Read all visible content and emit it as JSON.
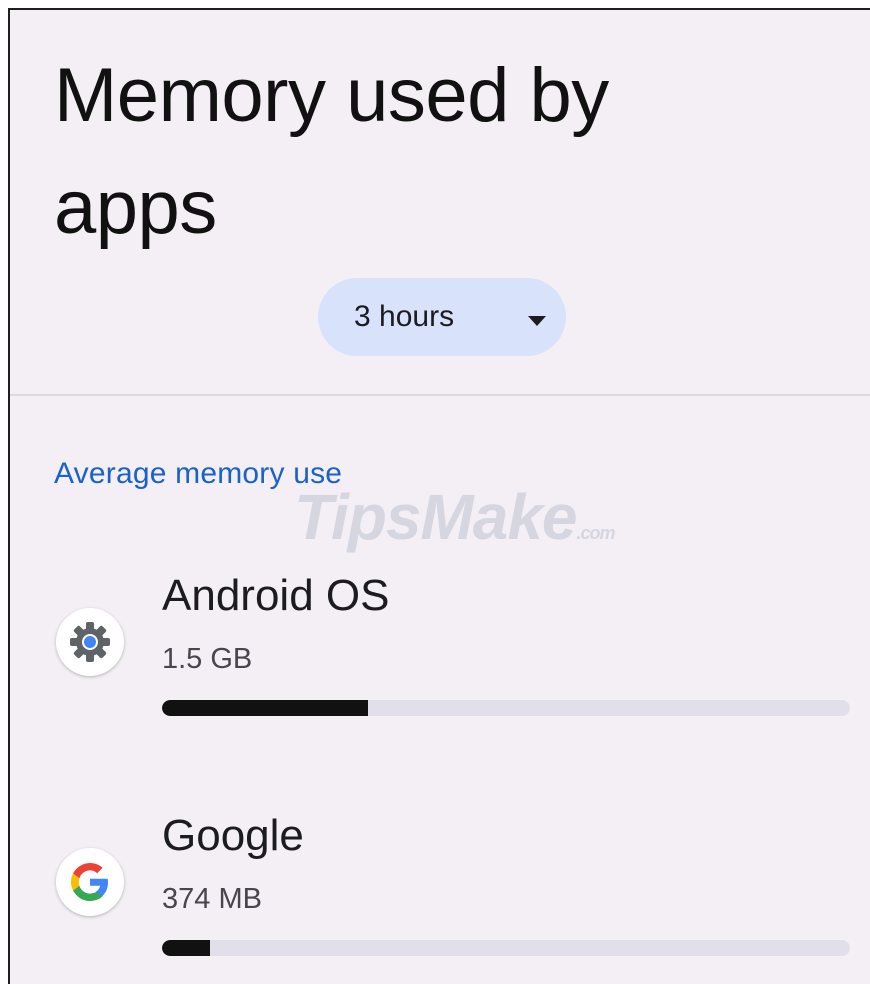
{
  "header": {
    "title": "Memory used by apps"
  },
  "period_selector": {
    "selected": "3 hours"
  },
  "section": {
    "label": "Average memory use"
  },
  "watermark": {
    "brand": "TipsMake",
    "tld": ".com"
  },
  "apps": [
    {
      "name": "Android OS",
      "size": "1.5 GB",
      "usage_fraction": 0.3,
      "icon": "gear-icon",
      "icon_color": "#5f6368",
      "icon_accent": "#4285f4"
    },
    {
      "name": "Google",
      "size": "374 MB",
      "usage_fraction": 0.07,
      "icon": "google-g-icon",
      "icon_colors": [
        "#4285f4",
        "#ea4335",
        "#fbbc05",
        "#34a853"
      ]
    }
  ],
  "colors": {
    "background": "#f3eff4",
    "chip": "#d8e3fb",
    "section_label": "#1a62c9",
    "bar_track": "#e1e0ea",
    "bar_fill": "#111111"
  }
}
